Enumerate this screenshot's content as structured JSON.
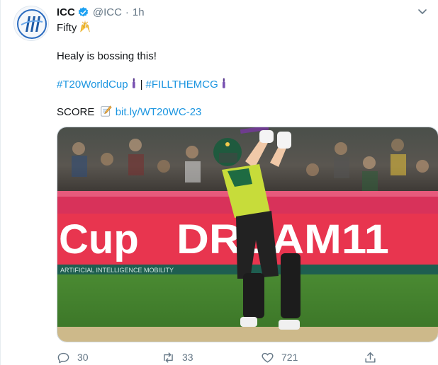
{
  "tweet": {
    "author_name": "ICC",
    "author_handle": "@ICC",
    "separator": "·",
    "time": "1h",
    "line1": "Fifty",
    "line1_emoji": "🙌",
    "line2": "Healy is bossing this!",
    "hashtag1": "#T20WorldCup",
    "divider": "|",
    "hashtag2": "#FILLTHEMCG",
    "score_label": "SCORE",
    "score_emoji": "📝",
    "score_link": "bit.ly/WT20WC-23"
  },
  "media": {
    "banner_left": "Cup",
    "banner_right": "DREAM11",
    "boundary_text": "ARTIFICIAL INTELLIGENCE MOBILITY"
  },
  "actions": {
    "replies": "30",
    "retweets": "33",
    "likes": "721"
  },
  "icons": {
    "avatar": "icc-logo-icon",
    "verified": "verified-badge-icon",
    "menu": "chevron-down-icon",
    "reply": "reply-icon",
    "retweet": "retweet-icon",
    "like": "heart-icon",
    "share": "share-icon",
    "hashtag_emoji": "cricket-bat-icon"
  },
  "colors": {
    "link": "#1b95e0",
    "verified": "#1da1f2",
    "text": "#14171a",
    "muted": "#657786"
  }
}
